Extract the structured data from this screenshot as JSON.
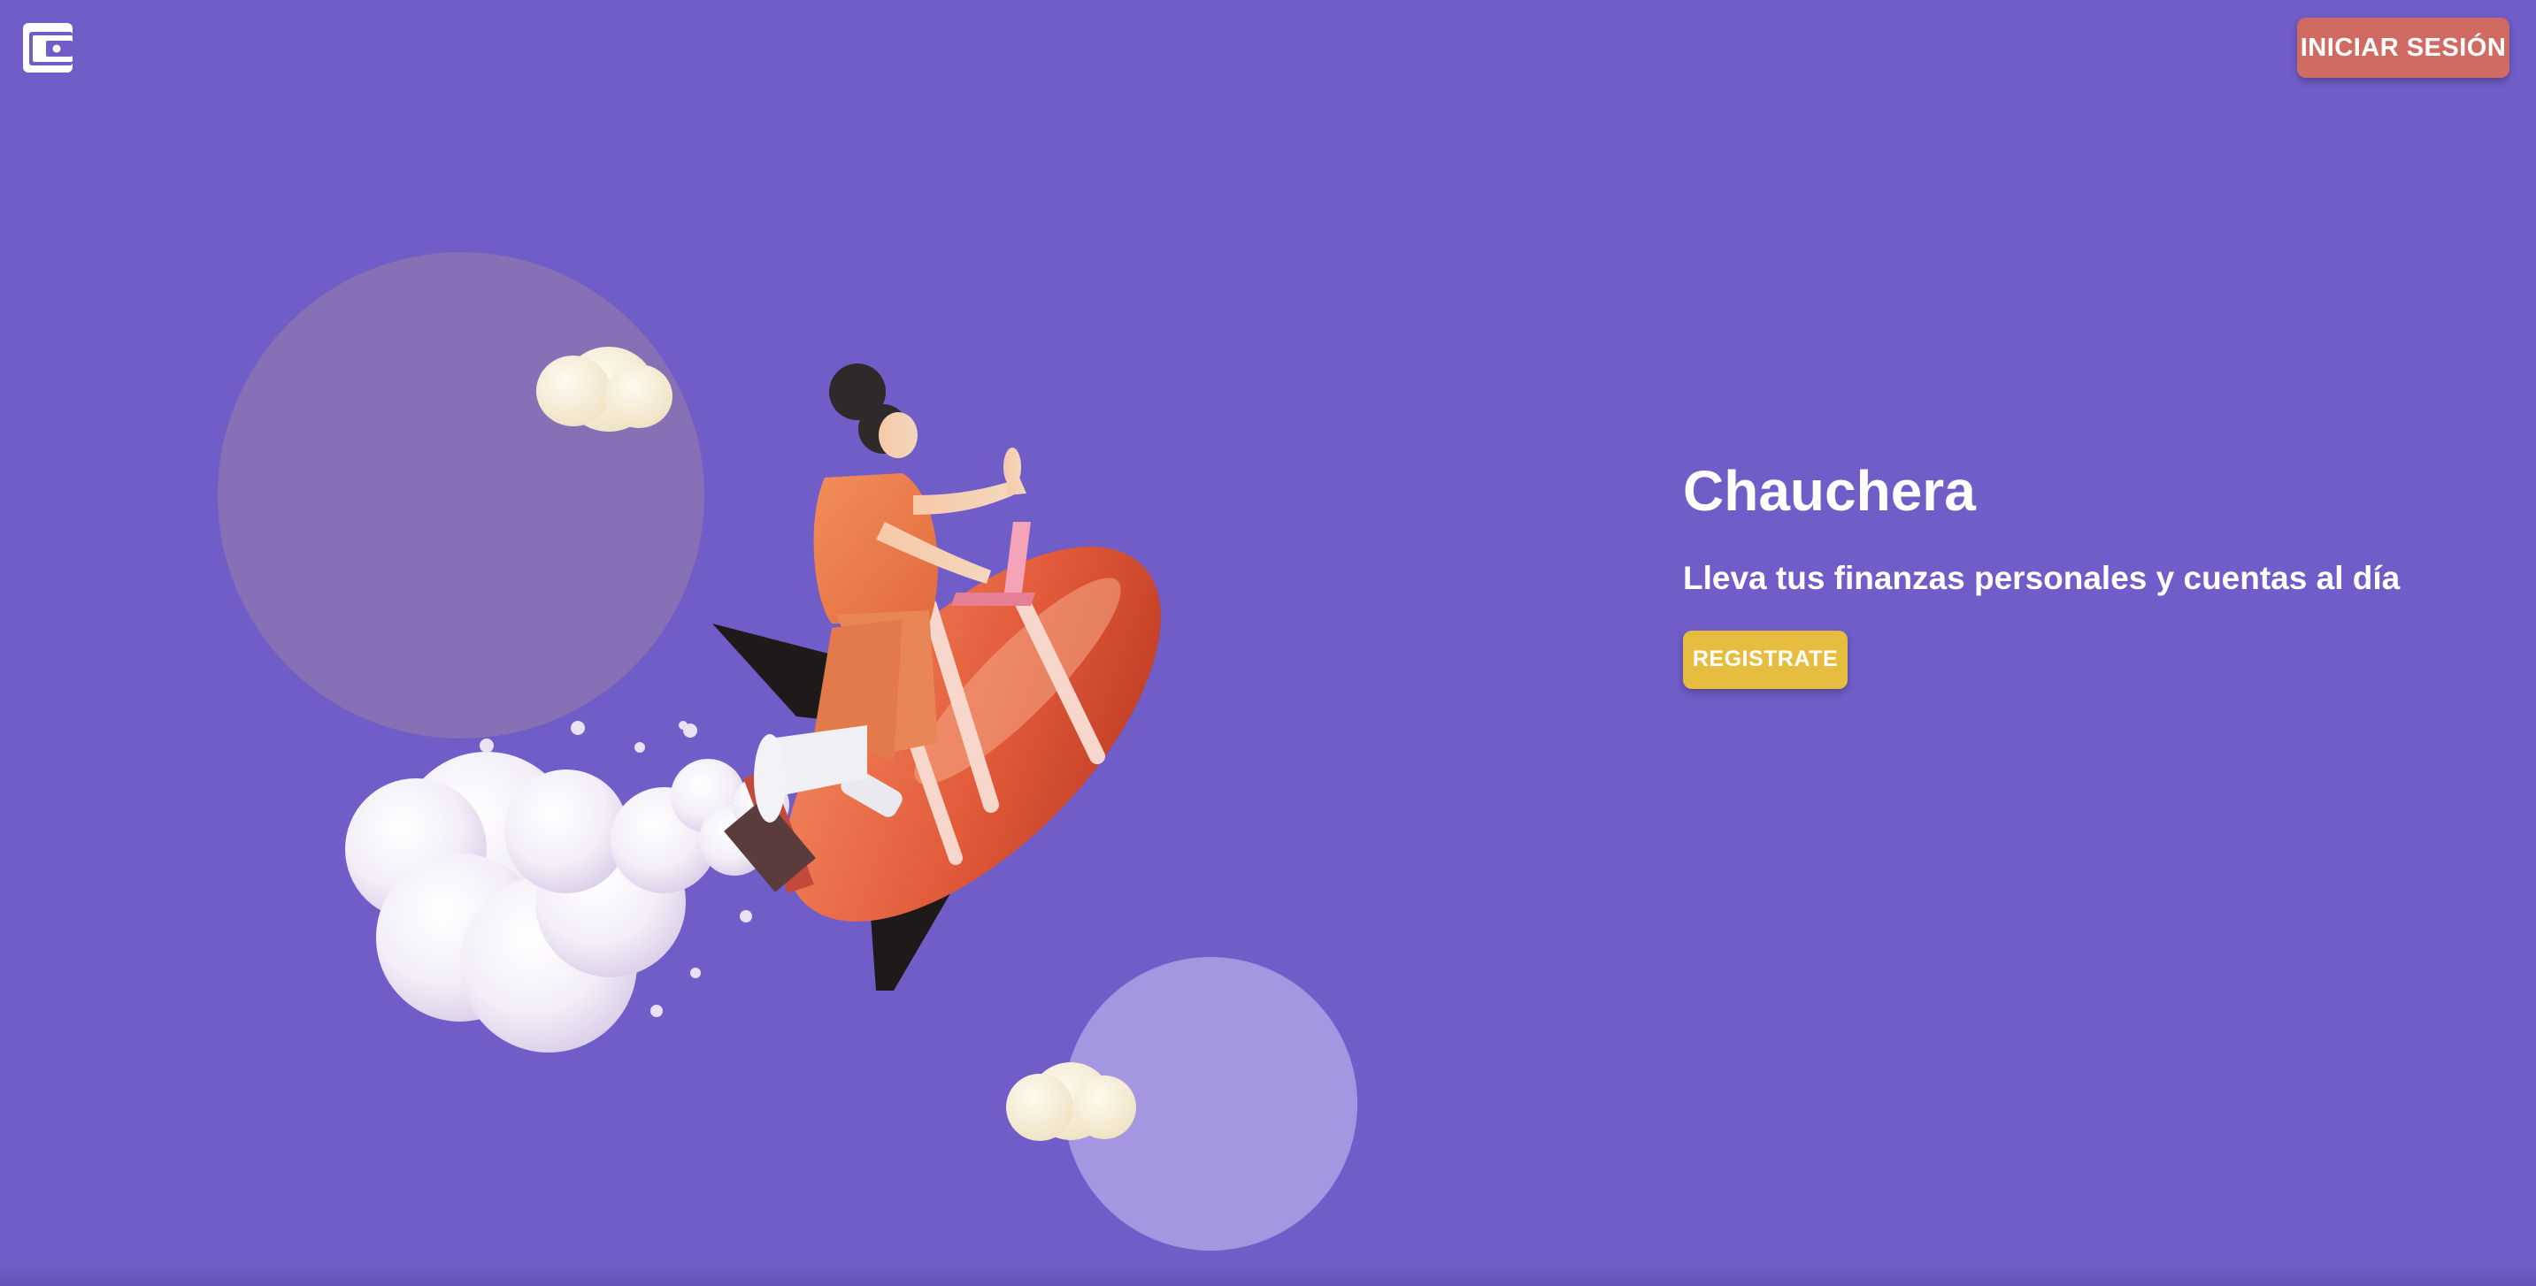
{
  "header": {
    "logo_icon": "wallet-icon",
    "login_label": "INICIAR SESIÓN"
  },
  "hero": {
    "title": "Chauchera",
    "tagline": "Lleva tus finanzas personales y cuentas al día",
    "register_label": "REGISTRATE",
    "illustration": "woman-riding-rocket-illustration"
  },
  "colors": {
    "background": "#705dc8",
    "login_button": "#cf6b63",
    "register_button": "#e6bd3f",
    "text": "#ffffff"
  }
}
